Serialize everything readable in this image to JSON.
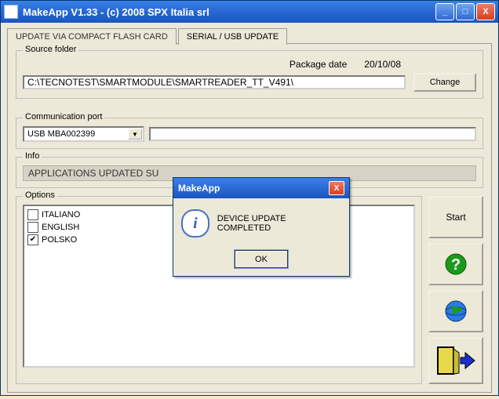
{
  "titlebar": {
    "title": "MakeApp V1.33  -  (c) 2008 SPX Italia srl"
  },
  "tabs": {
    "inactive": "UPDATE VIA COMPACT FLASH CARD",
    "active": "SERIAL / USB UPDATE"
  },
  "source": {
    "group_label": "Source folder",
    "package_label": "Package date",
    "package_date": "20/10/08",
    "path": "C:\\TECNOTEST\\SMARTMODULE\\SMARTREADER_TT_V491\\",
    "change_btn": "Change"
  },
  "comm": {
    "group_label": "Communication port",
    "selected": "USB MBA002399"
  },
  "info": {
    "group_label": "Info",
    "text": "APPLICATIONS UPDATED SU"
  },
  "options": {
    "group_label": "Options",
    "items": [
      {
        "label": "ITALIANO",
        "checked": false
      },
      {
        "label": "ENGLISH",
        "checked": false
      },
      {
        "label": "POLSKO",
        "checked": true
      }
    ]
  },
  "sidebar": {
    "start": "Start"
  },
  "dialog": {
    "title": "MakeApp",
    "message": "DEVICE UPDATE COMPLETED",
    "ok": "OK"
  }
}
